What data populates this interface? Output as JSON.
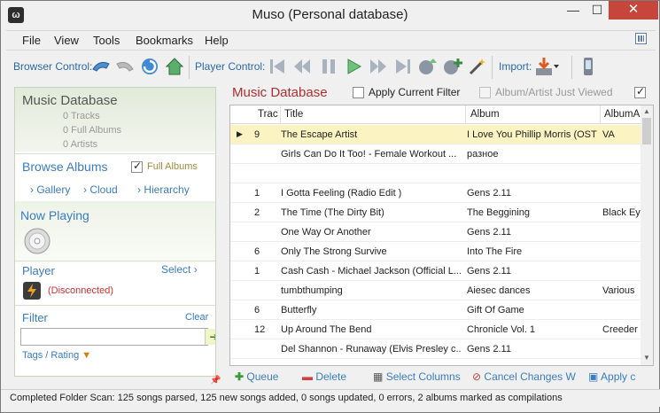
{
  "window": {
    "title": "Muso (Personal database)",
    "min": "—",
    "max": "☐",
    "close": "✕"
  },
  "menu": [
    "File",
    "View",
    "Tools",
    "Bookmarks",
    "Help"
  ],
  "toolbar": {
    "browser_label": "Browser Control:",
    "player_label": "Player Control:",
    "import_label": "Import:"
  },
  "sidebar": {
    "db_title": "Music Database",
    "tracks": "0  Tracks",
    "albums": "0  Full Albums",
    "artists": "0  Artists",
    "browse_title": "Browse Albums",
    "full_albums": "Full Albums",
    "gallery": "Gallery",
    "cloud": "Cloud",
    "hierarchy": "Hierarchy",
    "now_playing": "Now Playing",
    "player": "Player",
    "select": "Select",
    "disconnected": "(Disconnected)",
    "filter": "Filter",
    "clear": "Clear",
    "filter_value": "",
    "tags_rating": "Tags / Rating"
  },
  "main": {
    "title": "Music Database",
    "apply_filter": "Apply Current Filter",
    "album_artist_viewed": "Album/Artist Just Viewed",
    "columns": [
      "Trac",
      "Title",
      "Album",
      "AlbumA"
    ],
    "rows": [
      {
        "track": "9",
        "title": "The Escape Artist",
        "album": "I Love You Phillip Morris (OST)",
        "albumartist": "VA",
        "selected": true
      },
      {
        "track": "",
        "title": "Girls Can Do It Too! - Female Workout ...",
        "album": "разное",
        "albumartist": ""
      },
      {
        "track": "",
        "title": "",
        "album": "",
        "albumartist": ""
      },
      {
        "track": "1",
        "title": "I Gotta Feeling (Radio Edit )",
        "album": "Gens 2.11",
        "albumartist": ""
      },
      {
        "track": "2",
        "title": "The Time (The Dirty Bit)",
        "album": "The Beggining",
        "albumartist": "Black Ey"
      },
      {
        "track": "",
        "title": "One Way Or Another",
        "album": "Gens 2.11",
        "albumartist": ""
      },
      {
        "track": "6",
        "title": "Only The Strong Survive",
        "album": "Into The Fire",
        "albumartist": ""
      },
      {
        "track": "1",
        "title": "Cash Cash - Michael Jackson (Official L...",
        "album": "Gens 2.11",
        "albumartist": ""
      },
      {
        "track": "",
        "title": "tumbthumping",
        "album": "Aiesec dances",
        "albumartist": "Various"
      },
      {
        "track": "6",
        "title": "Butterfly",
        "album": "Gift Of Game",
        "albumartist": ""
      },
      {
        "track": "12",
        "title": "Up Around The Bend",
        "album": "Chronicle Vol. 1",
        "albumartist": "Creeder"
      },
      {
        "track": "",
        "title": "Del Shannon - Runaway (Elvis Presley c...",
        "album": "Gens 2.11",
        "albumartist": ""
      }
    ]
  },
  "bottom": {
    "queue": "Queue",
    "delete": "Delete",
    "select_columns": "Select Columns",
    "cancel_changes": "Cancel Changes",
    "apply": "Apply c"
  },
  "status": "Completed Folder Scan: 125 songs parsed, 125 new songs added, 0 songs updated, 0 errors, 2 albums marked as compilations"
}
